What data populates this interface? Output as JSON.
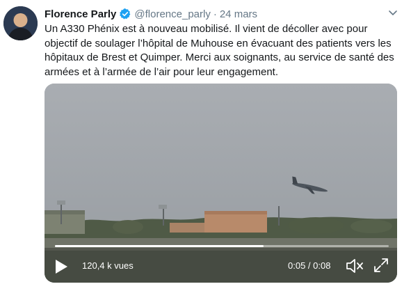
{
  "tweet": {
    "author_name": "Florence Parly",
    "handle": "@florence_parly",
    "separator": "·",
    "date": "24 mars",
    "text": "Un A330 Phénix est à nouveau mobilisé. Il vient de décoller avec pour objectif de soulager l’hôpital de Muhouse en évacuant des patients vers les hôpitaux de Brest et Quimper. Merci aux soignants, au service de santé des armées et à l’armée de l’air pour leur engagement."
  },
  "video": {
    "views": "120,4 k vues",
    "time": "0:05 / 0:08",
    "progress": 0.625
  },
  "icons": {
    "verified": "verified-badge-icon",
    "chevron": "chevron-down-icon",
    "play": "play-icon",
    "mute": "speaker-muted-icon",
    "fullscreen": "fullscreen-icon"
  },
  "colors": {
    "text": "#14171a",
    "secondary": "#657786",
    "verified": "#1da1f2"
  }
}
